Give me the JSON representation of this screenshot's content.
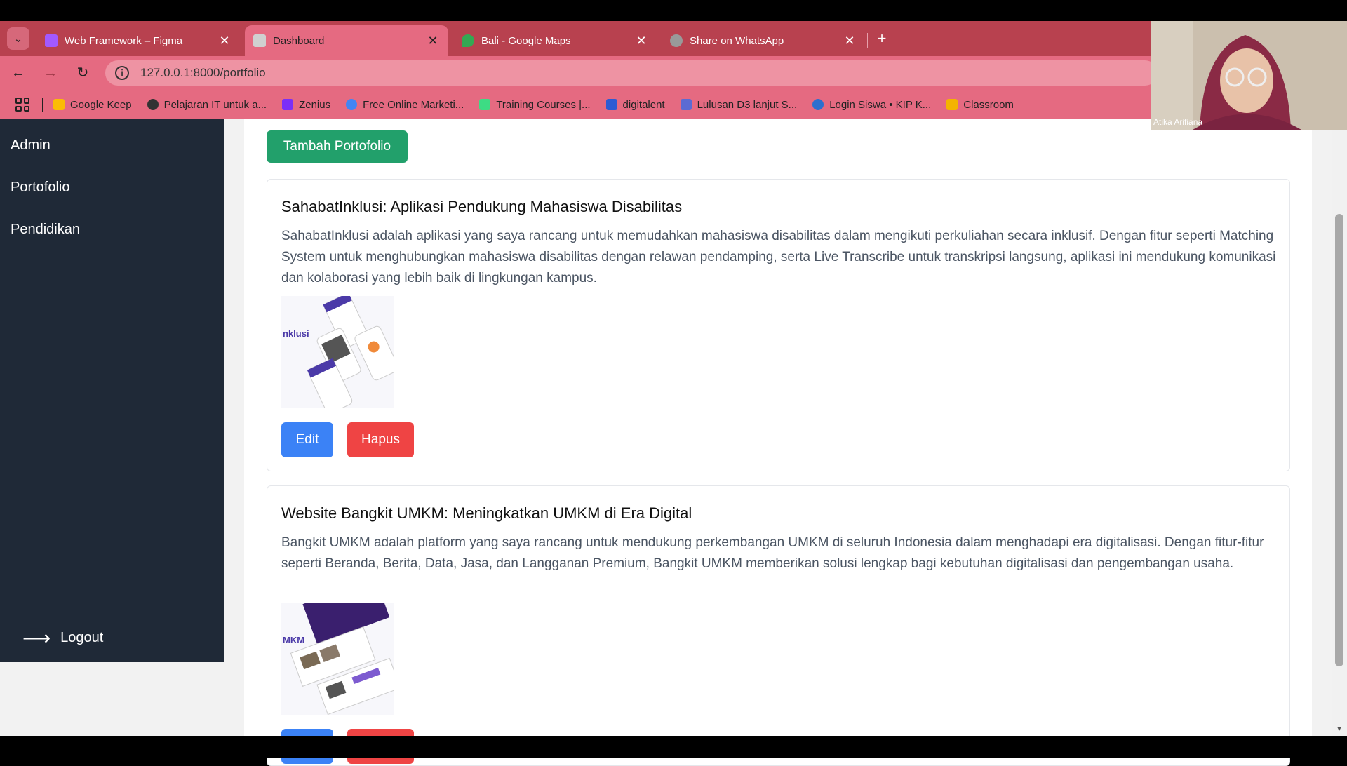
{
  "tabs": [
    {
      "label": "Web Framework – Figma",
      "favicon_color": "#a259ff",
      "active": false
    },
    {
      "label": "Dashboard",
      "favicon_color": "#d0d0d0",
      "active": true
    },
    {
      "label": "Bali - Google Maps",
      "favicon_color": "#34a853",
      "active": false
    },
    {
      "label": "Share on WhatsApp",
      "favicon_color": "#999999",
      "active": false
    }
  ],
  "address": {
    "url": "127.0.0.1:8000/portfolio"
  },
  "bookmarks": [
    {
      "label": "Google Keep",
      "color": "#fbbc04"
    },
    {
      "label": "Pelajaran IT untuk a...",
      "color": "#333333"
    },
    {
      "label": "Zenius",
      "color": "#7b2ff7"
    },
    {
      "label": "Free Online Marketi...",
      "color": "#4285f4"
    },
    {
      "label": "Training Courses  |...",
      "color": "#3ddc84"
    },
    {
      "label": "digitalent",
      "color": "#2d5bd3"
    },
    {
      "label": "Lulusan D3 lanjut S...",
      "color": "#5b6bd3"
    },
    {
      "label": "Login Siswa • KIP K...",
      "color": "#2c6fcf"
    },
    {
      "label": "Classroom",
      "color": "#f4b400"
    }
  ],
  "sidebar": {
    "items": [
      "Admin",
      "Portofolio",
      "Pendidikan"
    ],
    "logout_label": "Logout"
  },
  "main": {
    "add_button": "Tambah Portofolio",
    "edit_label": "Edit",
    "delete_label": "Hapus",
    "portfolios": [
      {
        "title": "SahabatInklusi: Aplikasi Pendukung Mahasiswa Disabilitas",
        "description": "SahabatInklusi adalah aplikasi yang saya rancang untuk memudahkan mahasiswa disabilitas dalam mengikuti perkuliahan secara inklusif. Dengan fitur seperti Matching System untuk menghubungkan mahasiswa disabilitas dengan relawan pendamping, serta Live Transcribe untuk transkripsi langsung, aplikasi ini mendukung komunikasi dan kolaborasi yang lebih baik di lingkungan kampus.",
        "thumb_text": "nklusi"
      },
      {
        "title": "Website Bangkit UMKM: Meningkatkan UMKM di Era Digital",
        "description": "Bangkit UMKM adalah platform yang saya rancang untuk mendukung perkembangan UMKM di seluruh Indonesia dalam menghadapi era digitalisasi. Dengan fitur-fitur seperti Beranda, Berita, Data, Jasa, dan Langganan Premium, Bangkit UMKM memberikan solusi lengkap bagi kebutuhan digitalisasi dan pengembangan usaha.",
        "thumb_text": "MKM"
      }
    ]
  },
  "webcam": {
    "name": "Atika Arifiana"
  }
}
